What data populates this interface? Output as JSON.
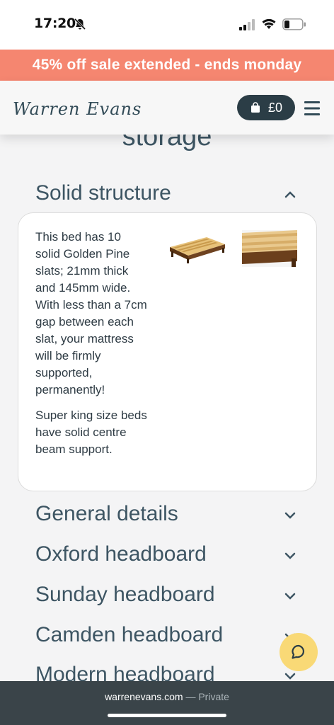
{
  "status_bar": {
    "time": "17:20"
  },
  "banner": {
    "text": "45% off sale extended - ends monday"
  },
  "header": {
    "logo": "Warren Evans",
    "cart_total": "£0"
  },
  "section": {
    "heading": "storage",
    "open_title": "Solid structure",
    "paragraphs": [
      "This bed has 10 solid Golden Pine slats; 21mm thick and 145mm wide. With less than a 7cm gap between each slat, your mattress will be firmly supported, permanently!",
      "Super king size beds have solid centre beam support."
    ]
  },
  "accordion": [
    {
      "label": "General details"
    },
    {
      "label": "Oxford headboard"
    },
    {
      "label": "Sunday headboard"
    },
    {
      "label": "Camden headboard"
    },
    {
      "label": "Modern headboard"
    }
  ],
  "browser": {
    "domain": "warrenevans.com",
    "separator": " — ",
    "mode": "Private"
  },
  "colors": {
    "banner": "#f58670",
    "cart": "#2b3d46",
    "chat": "#f9d976",
    "text": "#3d5563"
  }
}
